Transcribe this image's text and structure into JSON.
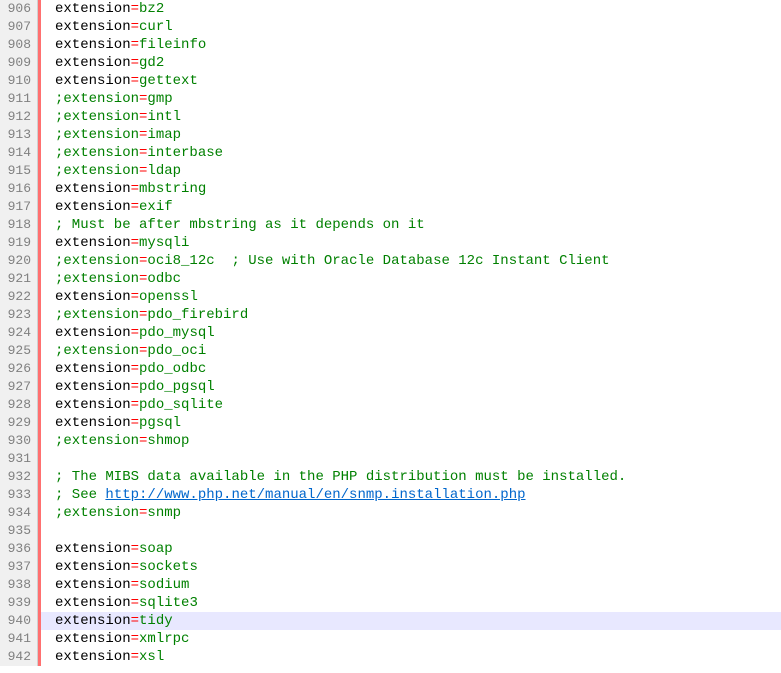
{
  "editor": {
    "highlighted_line": 940,
    "lines": [
      {
        "num": 906,
        "type": "ext",
        "value": "bz2"
      },
      {
        "num": 907,
        "type": "ext",
        "value": "curl"
      },
      {
        "num": 908,
        "type": "ext",
        "value": "fileinfo"
      },
      {
        "num": 909,
        "type": "ext",
        "value": "gd2"
      },
      {
        "num": 910,
        "type": "ext",
        "value": "gettext"
      },
      {
        "num": 911,
        "type": "cext",
        "value": "gmp"
      },
      {
        "num": 912,
        "type": "cext",
        "value": "intl"
      },
      {
        "num": 913,
        "type": "cext",
        "value": "imap"
      },
      {
        "num": 914,
        "type": "cext",
        "value": "interbase"
      },
      {
        "num": 915,
        "type": "cext",
        "value": "ldap"
      },
      {
        "num": 916,
        "type": "ext",
        "value": "mbstring"
      },
      {
        "num": 917,
        "type": "ext",
        "value": "exif"
      },
      {
        "num": 918,
        "type": "comment",
        "text": "; Must be after mbstring as it depends on it"
      },
      {
        "num": 919,
        "type": "ext",
        "value": "mysqli"
      },
      {
        "num": 920,
        "type": "cext_tail",
        "value": "oci8_12c",
        "tail": "  ; Use with Oracle Database 12c Instant Client"
      },
      {
        "num": 921,
        "type": "cext",
        "value": "odbc"
      },
      {
        "num": 922,
        "type": "ext",
        "value": "openssl"
      },
      {
        "num": 923,
        "type": "cext",
        "value": "pdo_firebird"
      },
      {
        "num": 924,
        "type": "ext",
        "value": "pdo_mysql"
      },
      {
        "num": 925,
        "type": "cext",
        "value": "pdo_oci"
      },
      {
        "num": 926,
        "type": "ext",
        "value": "pdo_odbc"
      },
      {
        "num": 927,
        "type": "ext",
        "value": "pdo_pgsql"
      },
      {
        "num": 928,
        "type": "ext",
        "value": "pdo_sqlite"
      },
      {
        "num": 929,
        "type": "ext",
        "value": "pgsql"
      },
      {
        "num": 930,
        "type": "cext",
        "value": "shmop"
      },
      {
        "num": 931,
        "type": "blank"
      },
      {
        "num": 932,
        "type": "comment",
        "text": "; The MIBS data available in the PHP distribution must be installed."
      },
      {
        "num": 933,
        "type": "comment_url",
        "prefix": "; See ",
        "url": "http://www.php.net/manual/en/snmp.installation.php"
      },
      {
        "num": 934,
        "type": "cext",
        "value": "snmp"
      },
      {
        "num": 935,
        "type": "blank"
      },
      {
        "num": 936,
        "type": "ext",
        "value": "soap"
      },
      {
        "num": 937,
        "type": "ext",
        "value": "sockets"
      },
      {
        "num": 938,
        "type": "ext",
        "value": "sodium"
      },
      {
        "num": 939,
        "type": "ext",
        "value": "sqlite3"
      },
      {
        "num": 940,
        "type": "ext",
        "value": "tidy"
      },
      {
        "num": 941,
        "type": "ext",
        "value": "xmlrpc"
      },
      {
        "num": 942,
        "type": "ext",
        "value": "xsl"
      }
    ]
  },
  "tokens": {
    "extension": "extension",
    "cextension": ";extension",
    "eq": "="
  }
}
